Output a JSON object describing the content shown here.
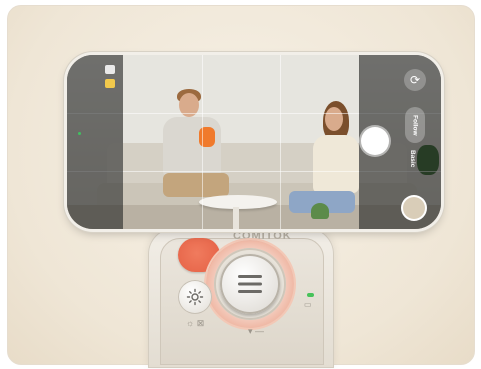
{
  "device": {
    "brand": "COMITOK",
    "menu_icon": "menu-icon",
    "light_icon": "sun-icon",
    "status_led_color": "#47c25a",
    "accent_color": "#e45f43"
  },
  "camera": {
    "mode_active": "Follow",
    "mode_other": "Basic",
    "flip_icon": "camera-flip-icon",
    "shutter_icon": "shutter-button",
    "thumbnail_icon": "gallery-thumbnail"
  }
}
